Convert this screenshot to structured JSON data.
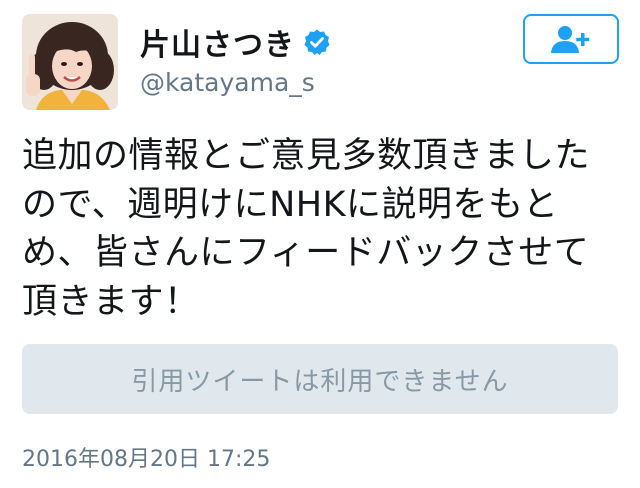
{
  "user": {
    "display_name": "片山さつき",
    "handle": "@katayama_s",
    "verified": true
  },
  "icons": {
    "avatar": "profile-photo",
    "verified": "verified-badge-icon",
    "follow": "follow-person-plus-icon"
  },
  "tweet": {
    "text_lines": [
      "追加の情報とご意見多数頂きました",
      "ので、週明けにNHKに説明をもと",
      "め、皆さんにフィードバックさせて",
      "頂きます！"
    ],
    "quote_unavailable": "引用ツイートは利用できません",
    "timestamp": "2016年08月20日 17:25"
  },
  "colors": {
    "accent": "#1da1f2",
    "text": "#14171a",
    "secondary_text": "#657786",
    "quote_bg": "#e1e8ed",
    "quote_text": "#8899a6"
  }
}
